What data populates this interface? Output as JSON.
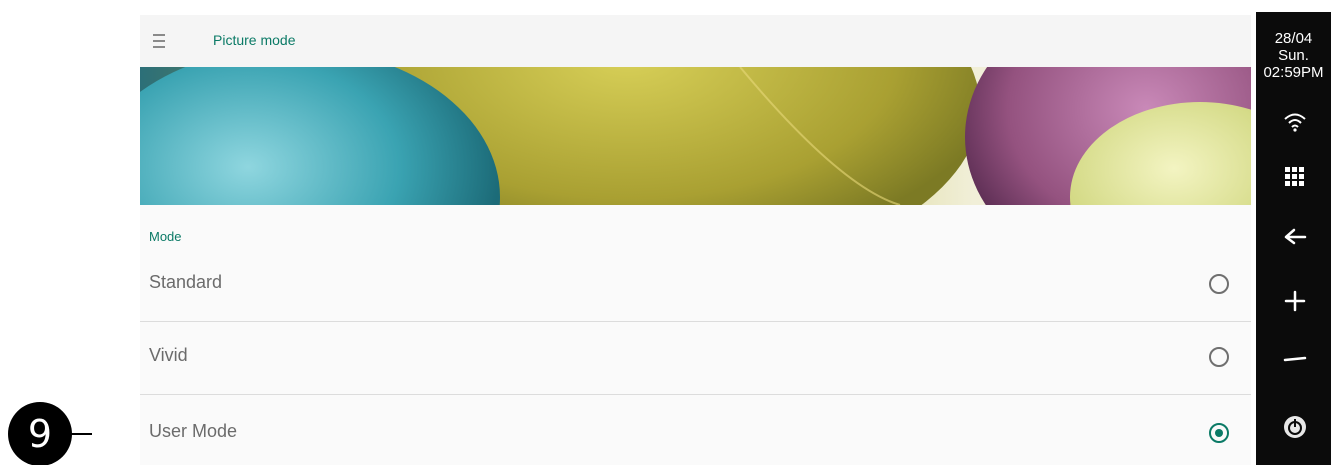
{
  "header": {
    "title": "Picture mode",
    "menu_icon": "menu-icon"
  },
  "section": {
    "label": "Mode"
  },
  "modes": [
    {
      "label": "Standard",
      "selected": false
    },
    {
      "label": "Vivid",
      "selected": false
    },
    {
      "label": "User Mode",
      "selected": true
    }
  ],
  "status": {
    "date": "28/04",
    "day": "Sun.",
    "time": "02:59PM"
  },
  "sidebar_icons": [
    "wifi-icon",
    "apps-icon",
    "back-icon",
    "volume-up-icon",
    "volume-down-icon",
    "power-icon"
  ],
  "callout": {
    "number": "9"
  },
  "colors": {
    "accent": "#0b7a66",
    "sidebar": "#0b0b0b",
    "panel": "#fafafa"
  }
}
